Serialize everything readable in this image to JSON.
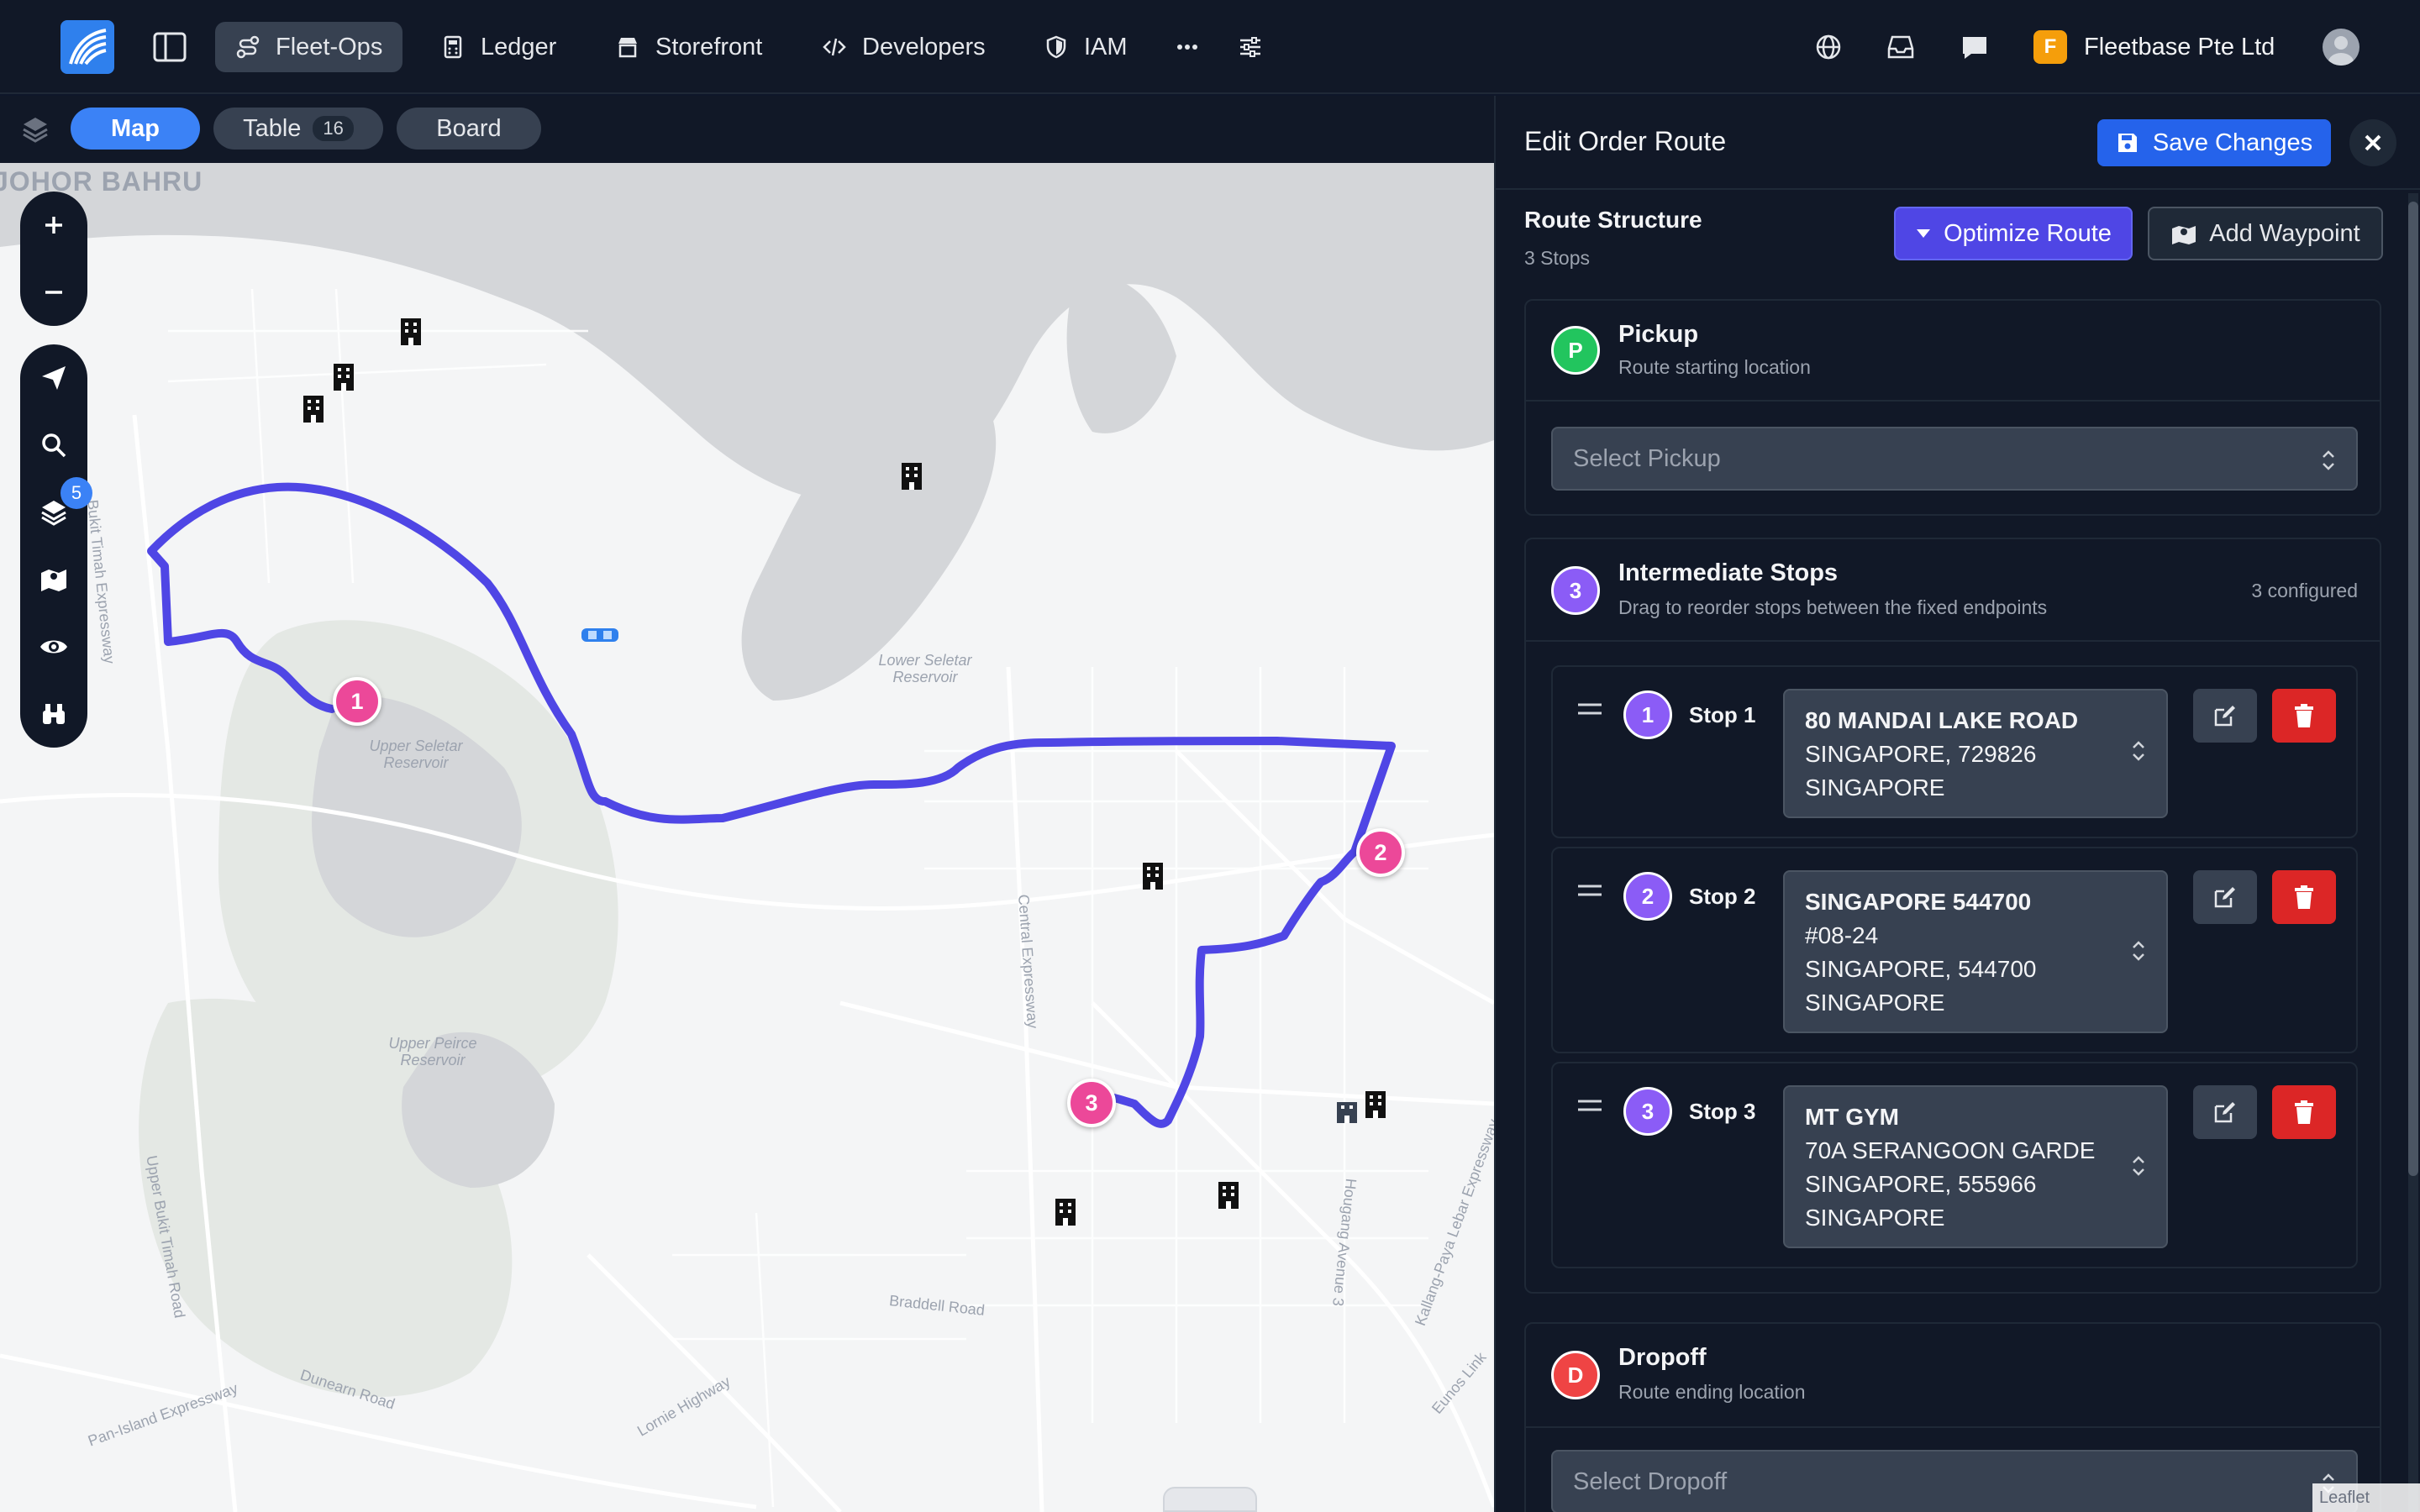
{
  "nav": {
    "items": [
      {
        "label": "Fleet-Ops",
        "icon": "route-icon",
        "active": true
      },
      {
        "label": "Ledger",
        "icon": "calculator-icon",
        "active": false
      },
      {
        "label": "Storefront",
        "icon": "store-icon",
        "active": false
      },
      {
        "label": "Developers",
        "icon": "code-icon",
        "active": false
      },
      {
        "label": "IAM",
        "icon": "shield-icon",
        "active": false
      }
    ],
    "more_icon": "ellipsis-icon",
    "settings_icon": "sliders-icon",
    "org_initial": "F",
    "org_name": "Fleetbase Pte Ltd"
  },
  "view_tabs": [
    {
      "label": "Map",
      "active": true
    },
    {
      "label": "Table",
      "count": "16",
      "active": false
    },
    {
      "label": "Board",
      "active": false
    }
  ],
  "map": {
    "city_label": "JOHOR BAHRU",
    "layer_count": "5",
    "place_labels": [
      "Upper Seletar Reservoir",
      "Lower Seletar Reservoir",
      "Upper Peirce Reservoir"
    ],
    "road_labels": [
      "Bukit Timah Expressway",
      "Upper Bukit Timah Road",
      "Braddell Road",
      "Dunearn Road",
      "Pan-Island Expressway",
      "Lornie Highway",
      "Central Expressway",
      "Hougang Avenue 3",
      "Kallang-Paya Lebar Expressway",
      "Eunos Link"
    ],
    "markers": [
      "1",
      "2",
      "3"
    ],
    "route_color": "#4f46e5",
    "marker_color": "#ec4899",
    "attribution": "Leaflet"
  },
  "panel": {
    "title": "Edit Order Route",
    "save_label": "Save Changes",
    "route_structure": {
      "title": "Route Structure",
      "subtitle": "3 Stops",
      "optimize_label": "Optimize Route",
      "waypoint_label": "Add Waypoint"
    },
    "pickup": {
      "badge": "P",
      "title": "Pickup",
      "subtitle": "Route starting location",
      "placeholder": "Select Pickup"
    },
    "intermediate": {
      "badge": "3",
      "title": "Intermediate Stops",
      "subtitle": "Drag to reorder stops between the fixed endpoints",
      "configured": "3 configured",
      "stops": [
        {
          "num": "1",
          "label": "Stop 1",
          "lines": [
            "80 MANDAI LAKE ROAD",
            "SINGAPORE, 729826",
            "SINGAPORE"
          ]
        },
        {
          "num": "2",
          "label": "Stop 2",
          "lines": [
            "SINGAPORE 544700",
            "#08-24",
            "SINGAPORE, 544700",
            "SINGAPORE"
          ]
        },
        {
          "num": "3",
          "label": "Stop 3",
          "lines": [
            "MT GYM",
            "70A SERANGOON GARDE",
            "SINGAPORE, 555966",
            "SINGAPORE"
          ]
        }
      ]
    },
    "dropoff": {
      "badge": "D",
      "title": "Dropoff",
      "subtitle": "Route ending location",
      "placeholder": "Select Dropoff"
    }
  },
  "colors": {
    "primary": "#2563eb",
    "indigo": "#4f46e5",
    "pickup": "#22c55e",
    "stop": "#8b5cf6",
    "dropoff": "#ef4444",
    "delete": "#dc2626"
  }
}
